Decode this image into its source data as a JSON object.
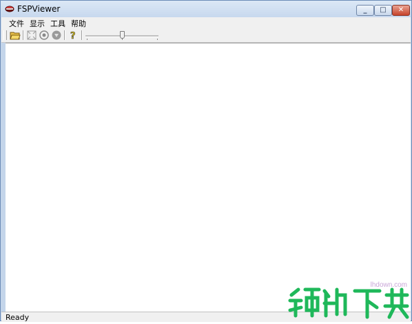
{
  "window": {
    "title": "FSPViewer"
  },
  "menu": {
    "items": [
      "文件",
      "显示",
      "工具",
      "帮助"
    ]
  },
  "toolbar": {
    "buttons": [
      "open-folder-icon",
      "fit-to-window-icon",
      "target-icon",
      "shield-icon",
      "help-icon"
    ],
    "slider": {
      "value_fraction": 0.5
    }
  },
  "status": {
    "text": "Ready"
  },
  "watermark": {
    "url": "lhdown.com",
    "text": "领航下载"
  },
  "colors": {
    "titlebar": "#c7d8ee",
    "close": "#c6432b",
    "watermark": "#1fb85a"
  }
}
